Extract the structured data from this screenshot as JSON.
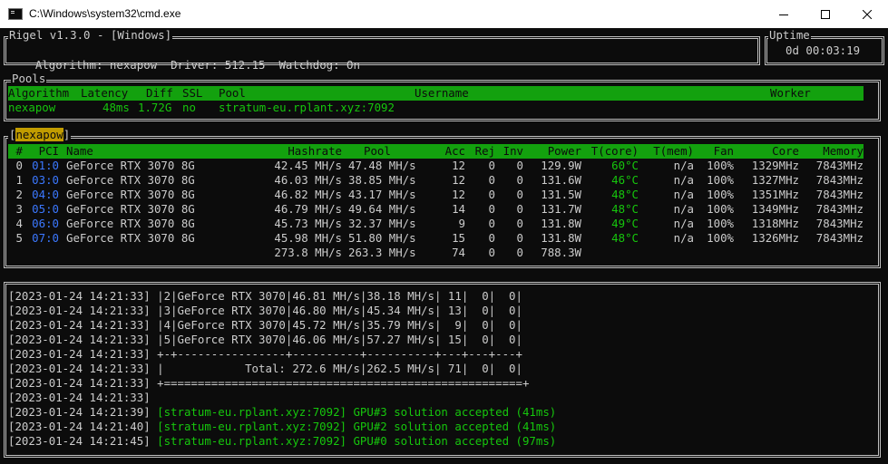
{
  "window": {
    "title": "C:\\Windows\\system32\\cmd.exe"
  },
  "header": {
    "title": "Rigel v1.3.0 - [Windows]",
    "algorithm_label": "Algorithm:",
    "algorithm": "nexapow",
    "driver_label": "Driver:",
    "driver": "512.15",
    "watchdog_label": "Watchdog:",
    "watchdog": "On"
  },
  "uptime": {
    "label": "Uptime",
    "value": "0d 00:03:19"
  },
  "pools": {
    "label": "Pools",
    "columns": [
      "Algorithm",
      "Latency",
      "Diff",
      "SSL",
      "Pool",
      "Username",
      "Worker"
    ],
    "row": {
      "algorithm": "nexapow",
      "latency": "48ms",
      "diff": "1.72G",
      "ssl": "no",
      "pool": "stratum-eu.rplant.xyz:7092",
      "username": "",
      "worker": ""
    }
  },
  "gpus": {
    "tab_label": "nexapow",
    "columns": [
      "#",
      "PCI",
      "Name",
      "Hashrate",
      "Pool",
      "Acc",
      "Rej",
      "Inv",
      "Power",
      "T(core)",
      "T(mem)",
      "Fan",
      "Core",
      "Memory"
    ],
    "rows": [
      [
        "0",
        "01:0",
        "GeForce RTX 3070 8G",
        "42.45 MH/s",
        "47.48 MH/s",
        "12",
        "0",
        "0",
        "129.9W",
        "60°C",
        "n/a",
        "100%",
        "1329MHz",
        "7843MHz"
      ],
      [
        "1",
        "03:0",
        "GeForce RTX 3070 8G",
        "46.03 MH/s",
        "38.85 MH/s",
        "12",
        "0",
        "0",
        "131.6W",
        "46°C",
        "n/a",
        "100%",
        "1327MHz",
        "7843MHz"
      ],
      [
        "2",
        "04:0",
        "GeForce RTX 3070 8G",
        "46.82 MH/s",
        "43.17 MH/s",
        "12",
        "0",
        "0",
        "131.5W",
        "48°C",
        "n/a",
        "100%",
        "1351MHz",
        "7843MHz"
      ],
      [
        "3",
        "05:0",
        "GeForce RTX 3070 8G",
        "46.79 MH/s",
        "49.64 MH/s",
        "14",
        "0",
        "0",
        "131.7W",
        "48°C",
        "n/a",
        "100%",
        "1349MHz",
        "7843MHz"
      ],
      [
        "4",
        "06:0",
        "GeForce RTX 3070 8G",
        "45.73 MH/s",
        "32.37 MH/s",
        "9",
        "0",
        "0",
        "131.8W",
        "49°C",
        "n/a",
        "100%",
        "1318MHz",
        "7843MHz"
      ],
      [
        "5",
        "07:0",
        "GeForce RTX 3070 8G",
        "45.98 MH/s",
        "51.80 MH/s",
        "15",
        "0",
        "0",
        "131.8W",
        "48°C",
        "n/a",
        "100%",
        "1326MHz",
        "7843MHz"
      ]
    ],
    "totals": {
      "hashrate": "273.8 MH/s",
      "pool": "263.3 MH/s",
      "acc": "74",
      "rej": "0",
      "inv": "0",
      "power": "788.3W"
    }
  },
  "log": {
    "lines": [
      {
        "ts": "[2023-01-24 14:21:33]",
        "text": "|2|GeForce RTX 3070|46.81 MH/s|38.18 MH/s| 11|  0|  0|",
        "green": false
      },
      {
        "ts": "[2023-01-24 14:21:33]",
        "text": "|3|GeForce RTX 3070|46.80 MH/s|45.34 MH/s| 13|  0|  0|",
        "green": false
      },
      {
        "ts": "[2023-01-24 14:21:33]",
        "text": "|4|GeForce RTX 3070|45.72 MH/s|35.79 MH/s|  9|  0|  0|",
        "green": false
      },
      {
        "ts": "[2023-01-24 14:21:33]",
        "text": "|5|GeForce RTX 3070|46.06 MH/s|57.27 MH/s| 15|  0|  0|",
        "green": false
      },
      {
        "ts": "[2023-01-24 14:21:33]",
        "text": "+-+----------------+----------+----------+---+---+---+",
        "green": false
      },
      {
        "ts": "[2023-01-24 14:21:33]",
        "text": "|            Total: 272.6 MH/s|262.5 MH/s| 71|  0|  0|",
        "green": false
      },
      {
        "ts": "[2023-01-24 14:21:33]",
        "text": "+=====================================================+",
        "green": false
      },
      {
        "ts": "[2023-01-24 14:21:33]",
        "text": "",
        "green": false
      },
      {
        "ts": "[2023-01-24 14:21:39]",
        "text": "[stratum-eu.rplant.xyz:7092] GPU#3 solution accepted (41ms)",
        "green": true
      },
      {
        "ts": "[2023-01-24 14:21:40]",
        "text": "[stratum-eu.rplant.xyz:7092] GPU#2 solution accepted (41ms)",
        "green": true
      },
      {
        "ts": "[2023-01-24 14:21:45]",
        "text": "[stratum-eu.rplant.xyz:7092] GPU#0 solution accepted (97ms)",
        "green": true
      }
    ]
  },
  "colors": {
    "background": "#0c0c0c",
    "text": "#cccccc",
    "green": "#16c60c",
    "header_bg": "#13a10e",
    "pci_blue": "#3b78ff",
    "tab_bg": "#c19c00"
  },
  "icons": {
    "app": "console-icon",
    "minimize": "minimize-icon",
    "maximize": "maximize-icon",
    "close": "close-icon"
  }
}
